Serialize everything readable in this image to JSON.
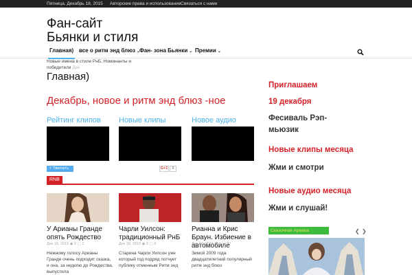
{
  "topbar": {
    "date": "Пятница, Декабрь 18, 2015",
    "links": [
      "Авторские права и использование",
      "Связаться с нами"
    ]
  },
  "logo": {
    "line1": "Фан-сайт",
    "line2": "Бьянки и стиля"
  },
  "nav": {
    "items": [
      {
        "label": "Главная)",
        "active": true,
        "dropdown": false
      },
      {
        "label": "все о ритм энд блюз",
        "active": false,
        "dropdown": true
      },
      {
        "label": "Фан- зона Бьянки",
        "active": false,
        "dropdown": true
      },
      {
        "label": "Премии",
        "active": false,
        "dropdown": true
      }
    ],
    "search_icon": "search-icon"
  },
  "ticker": {
    "text": "Новые имена в стиле РнБ. Номинанты и победители",
    "date": "Дек"
  },
  "page_title": "Главная)",
  "main_heading": "Декабрь, новое и ритм энд блюз -ное",
  "columns": [
    {
      "heading": "Рейтинг клипов"
    },
    {
      "heading": "Новые клипы"
    },
    {
      "heading": "Новое аудио"
    }
  ],
  "social": {
    "tweet_label": "Твитнуть",
    "gplus_label": "G+1",
    "gplus_count": "6"
  },
  "section_tag": "RNB",
  "articles": [
    {
      "title": "У Арианы Гранде опять Рождество",
      "date": "Дек 18, 2015",
      "views": "0",
      "comments": "2",
      "excerpt": "Нежному голосу Арианы Гранде очень подходит сказка, и она, за неделю до Рождества, выпустила"
    },
    {
      "title": "Чарли Уилсон: традиционный РнБ",
      "date": "Дек 18, 2015",
      "views": "0",
      "comments": "0",
      "excerpt": "Старина Чарли Уилсон уже который год подряд потчует публику отменным Ритм энд"
    },
    {
      "title": "Рианна и Крис Браун. Избиение в автомобиле",
      "date": "Дек 17, 2015",
      "views": "0",
      "comments": "27",
      "excerpt": "Зимой 2009 года двадцатилетний популярный ритм энд блюз"
    }
  ],
  "sidebar": {
    "lines": [
      {
        "text": "Приглашаем",
        "style": "red"
      },
      {
        "text": "19 декабря",
        "style": "red"
      },
      {
        "text": "Фесиваль Рэп-",
        "style": "dark"
      },
      {
        "text": "мьюзик",
        "style": "dark"
      },
      {
        "text": "Новые клипы месяца",
        "style": "red"
      },
      {
        "text": "Жми и смотри",
        "style": "dark"
      },
      {
        "text": "Новые аудио месяца",
        "style": "red"
      },
      {
        "text": "Жми и слушай!",
        "style": "dark"
      }
    ],
    "widget_title": "Сказочная Ариана",
    "prev_icon": "chevron-left-icon",
    "next_icon": "chevron-right-icon"
  },
  "colors": {
    "accent_red": "#d12127",
    "accent_blue": "#4db2ec",
    "widget_green": "#3dbb3d"
  }
}
